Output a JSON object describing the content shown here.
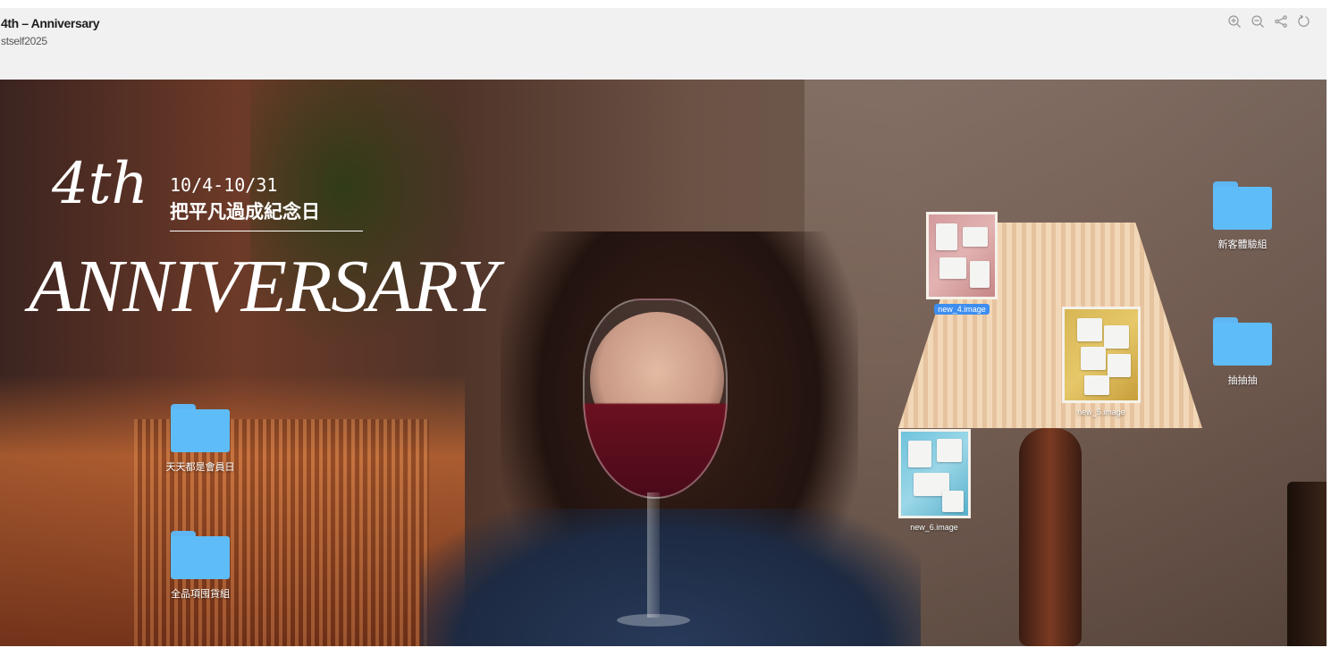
{
  "header": {
    "title": "4th – Anniversary",
    "subtitle": "stself2025",
    "tools": [
      {
        "icon": "zoom-in-icon"
      },
      {
        "icon": "zoom-out-icon"
      },
      {
        "icon": "share-icon"
      },
      {
        "icon": "reset-icon"
      }
    ]
  },
  "poster": {
    "ordinal": "4th",
    "dates": "10/4-10/31",
    "tagline": "把平凡過成紀念日",
    "headline": "ANNIVERSARY"
  },
  "desktop": {
    "folders": [
      {
        "label": "天天都是會員日"
      },
      {
        "label": "全品項囤貨組"
      },
      {
        "label": "新客體驗組"
      },
      {
        "label": "抽抽抽"
      }
    ],
    "images": [
      {
        "label": "new_4.image",
        "selected": true
      },
      {
        "label": "new_5.image",
        "selected": false
      },
      {
        "label": "new_6.image",
        "selected": false
      }
    ]
  },
  "colors": {
    "folder": "#5ebdf8",
    "selection": "#3e8ef0",
    "header_bg": "#f1f1f1"
  }
}
